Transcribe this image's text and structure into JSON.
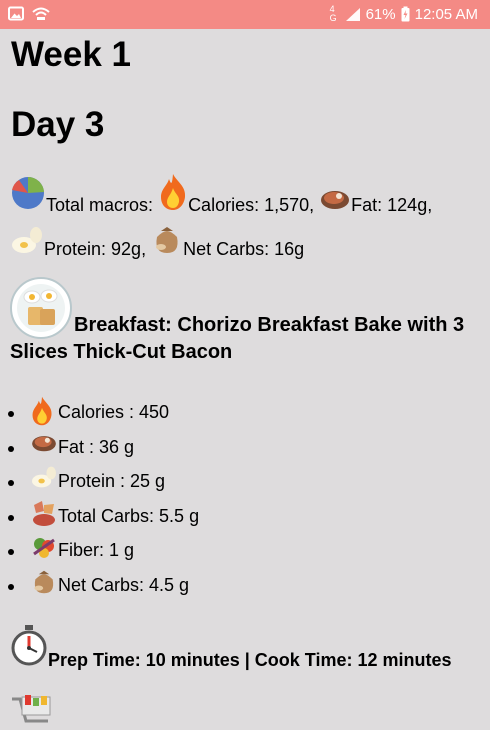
{
  "status_bar": {
    "network": "4G",
    "battery": "61%",
    "time": "12:05 AM"
  },
  "week_title": "Week 1",
  "day_title": "Day 3",
  "total_macros": {
    "label": "Total macros:",
    "calories": "Calories: 1,570,",
    "fat": "Fat: 124g,",
    "protein": "Protein: 92g,",
    "net_carbs": "Net Carbs: 16g"
  },
  "meal": {
    "title": "Breakfast: Chorizo Breakfast Bake with 3 Slices Thick-Cut Bacon",
    "facts": [
      {
        "icon": "fire-icon",
        "text": "Calories : 450"
      },
      {
        "icon": "steak-icon",
        "text": "Fat : 36 g"
      },
      {
        "icon": "egg-icon",
        "text": "Protein : 25 g"
      },
      {
        "icon": "carbs-icon",
        "text": "Total Carbs: 5.5 g"
      },
      {
        "icon": "veggie-icon",
        "text": "Fiber: 1 g"
      },
      {
        "icon": "sack-icon",
        "text": "Net Carbs: 4.5 g"
      }
    ],
    "prep": "Prep Time: 10 minutes | Cook Time: 12 minutes"
  },
  "colors": {
    "status_bar": "#f48a85",
    "background": "#dedcdd"
  }
}
